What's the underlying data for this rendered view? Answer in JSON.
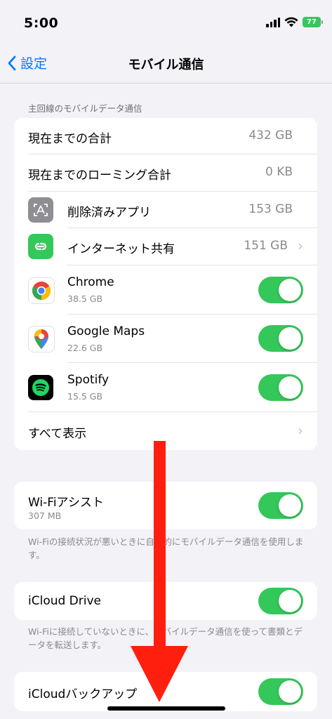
{
  "status_bar": {
    "time": "5:00",
    "battery": "77"
  },
  "nav": {
    "back_label": "設定",
    "title": "モバイル通信"
  },
  "usage_section": {
    "header": "主回線のモバイルデータ通信",
    "rows": [
      {
        "label": "現在までの合計",
        "value": "432 GB"
      },
      {
        "label": "現在までのローミング合計",
        "value": "0 KB"
      },
      {
        "label": "削除済みアプリ",
        "value": "153 GB",
        "icon": "deleted-apps-icon"
      },
      {
        "label": "インターネット共有",
        "value": "151 GB",
        "icon": "hotspot-icon"
      },
      {
        "label": "Chrome",
        "sub": "38.5 GB",
        "icon": "chrome-icon",
        "enabled": true
      },
      {
        "label": "Google Maps",
        "sub": "22.6 GB",
        "icon": "google-maps-icon",
        "enabled": true
      },
      {
        "label": "Spotify",
        "sub": "15.5 GB",
        "icon": "spotify-icon",
        "enabled": true
      },
      {
        "label": "すべて表示"
      }
    ]
  },
  "wifi_assist": {
    "label": "Wi-Fiアシスト",
    "sub": "307 MB",
    "enabled": true,
    "footnote": "Wi-Fiの接続状況が悪いときに自動的にモバイルデータ通信を使用します。"
  },
  "icloud_drive": {
    "label": "iCloud Drive",
    "enabled": true,
    "footnote": "Wi-Fiに接続していないときに、モバイルデータ通信を使って書類とデータを転送します。"
  },
  "icloud_backup": {
    "label": "iCloudバックアップ",
    "enabled": true
  },
  "colors": {
    "accent": "#007aff",
    "toggle_on": "#34c759",
    "annotation_arrow": "#ff1f0f",
    "hotspot_green": "#34c759",
    "deleted_apps_gray": "#8e8e93"
  }
}
